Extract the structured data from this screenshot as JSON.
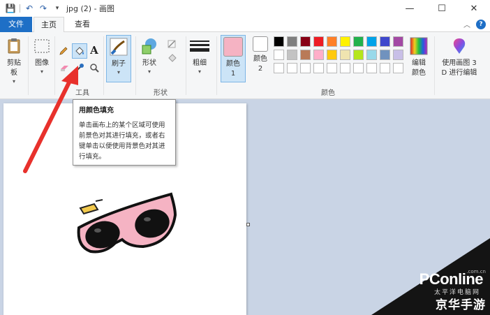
{
  "window": {
    "title": "jpg (2) - 画图",
    "controls": {
      "minimize": "—",
      "maximize": "☐",
      "close": "✕"
    }
  },
  "quick_access": {
    "save": "💾",
    "undo": "↶",
    "redo": "↷",
    "more": "▾"
  },
  "tabs": [
    {
      "label": "文件",
      "active": false
    },
    {
      "label": "主页",
      "active": true
    },
    {
      "label": "查看",
      "active": false
    }
  ],
  "ribbon_right": {
    "collapse": "︿",
    "help": "?"
  },
  "ribbon": {
    "clipboard": {
      "label": "剪贴板",
      "arrow": "▾"
    },
    "image": {
      "label": "图像",
      "arrow": "▾"
    },
    "tools": {
      "group_label": "工具"
    },
    "brushes": {
      "label": "刷子",
      "arrow": "▾"
    },
    "shapes": {
      "label": "形状",
      "arrow": "▾",
      "group_label": "形状"
    },
    "size": {
      "label": "粗细",
      "arrow": "▾"
    },
    "color1": {
      "label": "颜色 1",
      "color": "#f5b3c3"
    },
    "color2": {
      "label": "颜色 2",
      "color": "#ffffff"
    },
    "edit_colors": {
      "label": "编辑颜色"
    },
    "paint3d": {
      "label": "使用画图 3D 进行编辑"
    },
    "colors_group_label": "颜色"
  },
  "palette": {
    "row1": [
      "#000000",
      "#7f7f7f",
      "#880015",
      "#ed1c24",
      "#ff7f27",
      "#fff200",
      "#22b14c",
      "#00a2e8",
      "#3f48cc",
      "#a349a4"
    ],
    "row2": [
      "#ffffff",
      "#c3c3c3",
      "#b97a57",
      "#ffaec9",
      "#ffc90e",
      "#efe4b0",
      "#b5e61d",
      "#99d9ea",
      "#7092be",
      "#c8bfe7"
    ],
    "row3": [
      "#ffffff",
      "#ffffff",
      "#ffffff",
      "#ffffff",
      "#ffffff",
      "#ffffff",
      "#ffffff",
      "#ffffff",
      "#ffffff",
      "#ffffff"
    ]
  },
  "tooltip": {
    "title": "用颜色填充",
    "body": "单击画布上的某个区域可使用前景色对其进行填充，或者右键单击以便使用背景色对其进行填充。"
  },
  "watermark": {
    "brand": "PConline",
    "domain": ".com.cn",
    "sub": "太平洋电脑网",
    "site": "京华手游"
  }
}
